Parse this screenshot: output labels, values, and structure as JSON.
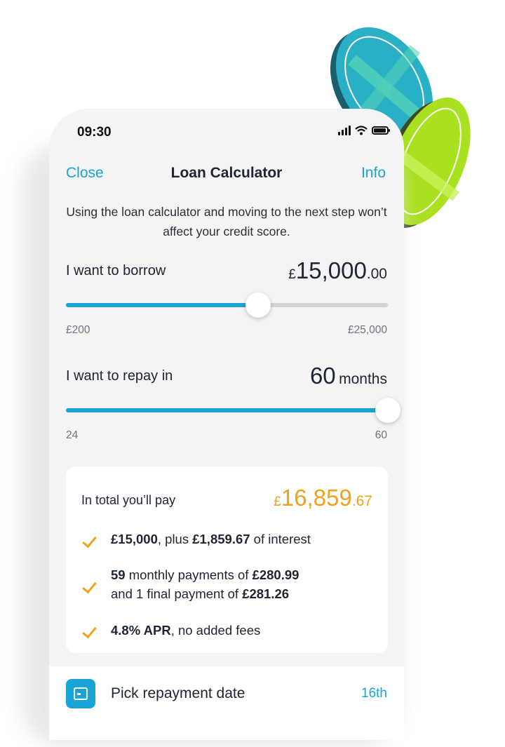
{
  "status": {
    "time": "09:30"
  },
  "nav": {
    "close": "Close",
    "title": "Loan Calculator",
    "info": "Info"
  },
  "intro": "Using the loan calculator and moving to the next step won’t affect your credit score.",
  "borrow": {
    "label": "I want to borrow",
    "currency": "£",
    "amount_main": "15,000",
    "amount_decimal": ".00",
    "min": "£200",
    "max": "£25,000",
    "value": 15000,
    "range": [
      200,
      25000
    ]
  },
  "repay": {
    "label": "I want to repay in",
    "value_text": "60",
    "unit": "months",
    "min": "24",
    "max": "60",
    "value": 60,
    "range": [
      24,
      60
    ]
  },
  "total": {
    "label": "In total you’ll pay",
    "currency": "£",
    "amount_main": "16,859",
    "amount_decimal": ".67",
    "points": {
      "p1": {
        "b1": "£15,000",
        "t1": ", plus ",
        "b2": "£1,859.67",
        "t2": " of interest"
      },
      "p2": {
        "b1": "59",
        "t1": " monthly payments of ",
        "b2": "£280.99",
        "t2": "and 1 final payment of ",
        "b3": "£281.26"
      },
      "p3": {
        "b1": "4.8% APR",
        "t1": ", no added fees"
      }
    }
  },
  "repayment_date": {
    "label": "Pick repayment date",
    "value": "16th",
    "icon": "calendar-icon"
  },
  "colors": {
    "accent": "#1aa3d6",
    "total": "#f0a21c",
    "coin_teal": "#2ab0c4",
    "coin_lime": "#a9e01f"
  }
}
